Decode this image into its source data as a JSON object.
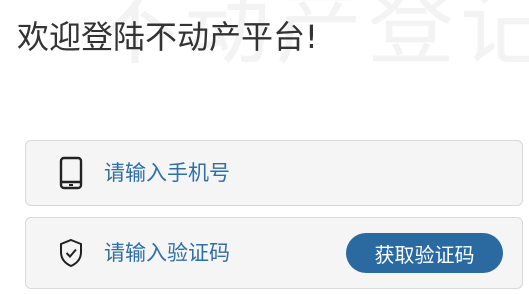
{
  "header": {
    "watermark": "不动产登记",
    "title": "欢迎登陆不动产平台!"
  },
  "login": {
    "phone": {
      "icon": "phone-icon",
      "placeholder": "请输入手机号",
      "value": ""
    },
    "code": {
      "icon": "shield-check-icon",
      "placeholder": "请输入验证码",
      "value": "",
      "button_label": "获取验证码"
    }
  },
  "colors": {
    "accent": "#2a6aa0",
    "placeholder": "#2f6fa5",
    "field_background": "#f5f5f5",
    "field_border": "#d9d9d9",
    "title": "#333333"
  }
}
